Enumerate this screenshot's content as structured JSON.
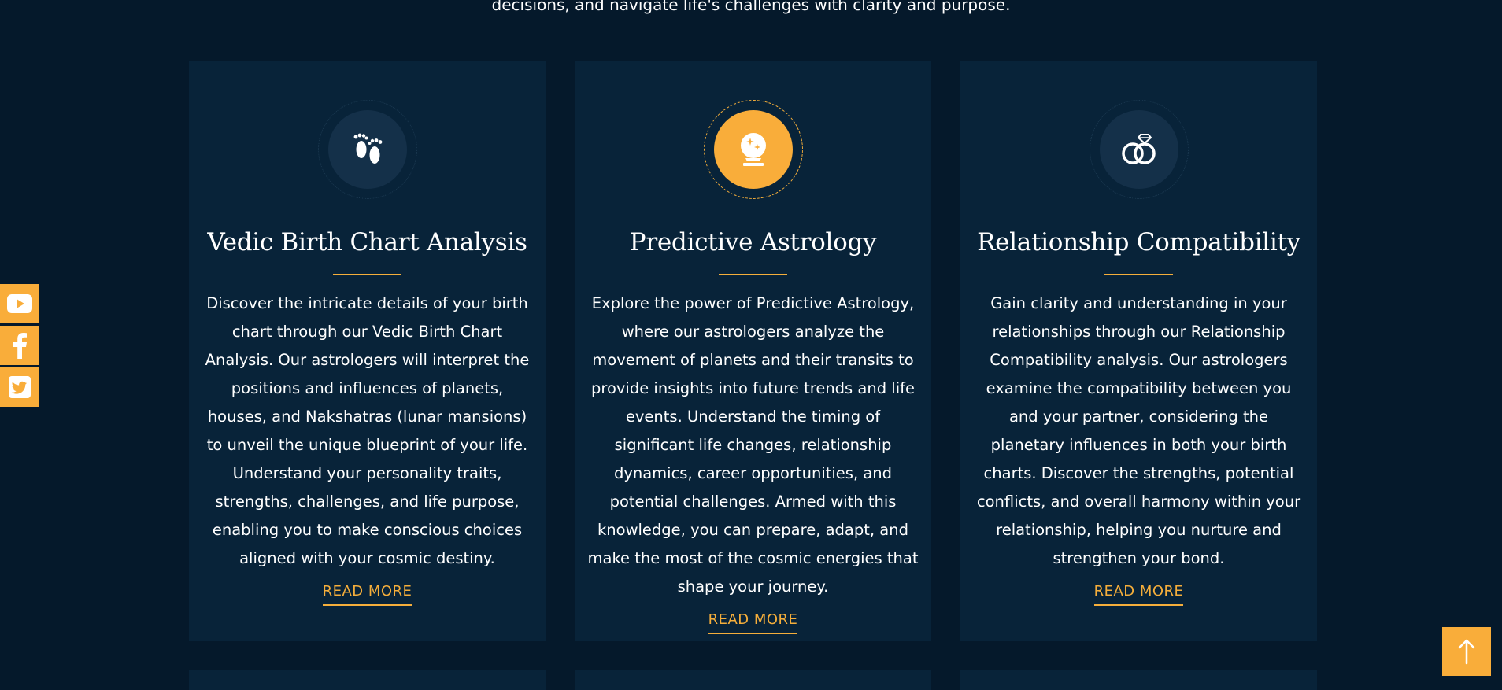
{
  "intro": {
    "text": "decisions, and navigate life's challenges with clarity and purpose."
  },
  "services": [
    {
      "icon": "baby-footprints-icon",
      "title": "Vedic Birth Chart Analysis",
      "description": "Discover the intricate details of your birth chart through our Vedic Birth Chart Analysis. Our astrologers will interpret the positions and influences of planets, houses, and Nakshatras (lunar mansions) to unveil the unique blueprint of your life. Understand your personality traits, strengths, challenges, and life purpose, enabling you to make conscious choices aligned with your cosmic destiny.",
      "cta": "READ MORE"
    },
    {
      "icon": "crystal-ball-icon",
      "title": "Predictive Astrology",
      "description": "Explore the power of Predictive Astrology, where our astrologers analyze the movement of planets and their transits to provide insights into future trends and life events. Understand the timing of significant life changes, relationship dynamics, career opportunities, and potential challenges. Armed with this knowledge, you can prepare, adapt, and make the most of the cosmic energies that shape your journey.",
      "cta": "READ MORE"
    },
    {
      "icon": "wedding-rings-icon",
      "title": "Relationship Compatibility",
      "description": "Gain clarity and understanding in your relationships through our Relationship Compatibility analysis. Our astrologers examine the compatibility between you and your partner, considering the planetary influences in both your birth charts. Discover the strengths, potential conflicts, and overall harmony within your relationship, helping you nurture and strengthen your bond.",
      "cta": "READ MORE"
    }
  ],
  "social": [
    "youtube-icon",
    "facebook-icon",
    "twitter-icon"
  ],
  "colors": {
    "background": "#05192b",
    "card": "#082339",
    "accent": "#f9ad3a"
  }
}
